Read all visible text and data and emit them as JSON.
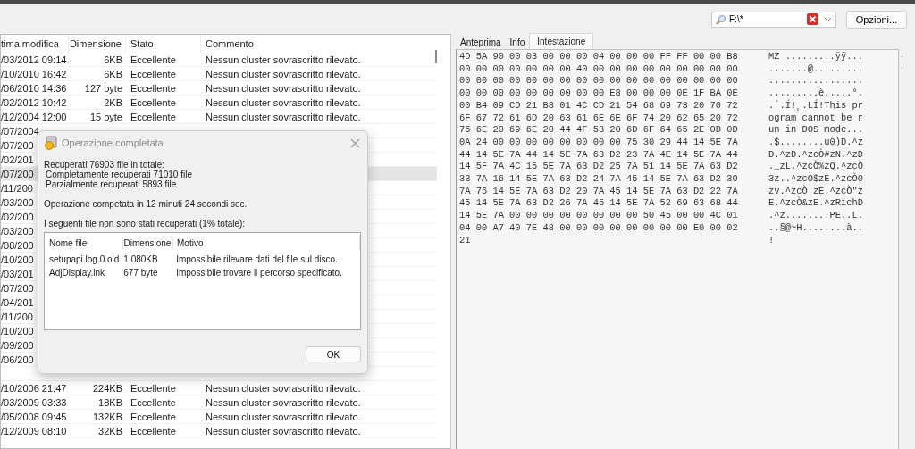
{
  "search": {
    "value": "F:\\*"
  },
  "options_button": "Opzioni...",
  "table": {
    "columns": [
      "tima modifica",
      "Dimensione",
      "Stato",
      "Commento"
    ],
    "rows": [
      {
        "modified": "/03/2012 09:14",
        "size": "6KB",
        "status": "Eccellente",
        "comment": "Nessun cluster sovrascritto rilevato.",
        "selected": false
      },
      {
        "modified": "/10/2010 16:42",
        "size": "6KB",
        "status": "Eccellente",
        "comment": "Nessun cluster sovrascritto rilevato.",
        "selected": false
      },
      {
        "modified": "/06/2010 14:36",
        "size": "127 byte",
        "status": "Eccellente",
        "comment": "Nessun cluster sovrascritto rilevato.",
        "selected": false
      },
      {
        "modified": "/02/2012 10:42",
        "size": "2KB",
        "status": "Eccellente",
        "comment": "Nessun cluster sovrascritto rilevato.",
        "selected": false
      },
      {
        "modified": "/12/2004 12:00",
        "size": "15 byte",
        "status": "Eccellente",
        "comment": "Nessun cluster sovrascritto rilevato.",
        "selected": false
      },
      {
        "modified": "/07/2004",
        "selected": false
      },
      {
        "modified": "/07/200",
        "selected": false
      },
      {
        "modified": "/02/201",
        "selected": false
      },
      {
        "modified": "/07/200",
        "selected": true
      },
      {
        "modified": "/11/200",
        "selected": false
      },
      {
        "modified": "/03/200",
        "selected": false
      },
      {
        "modified": "/02/200",
        "selected": false
      },
      {
        "modified": "/03/200",
        "selected": false
      },
      {
        "modified": "/08/200",
        "selected": false
      },
      {
        "modified": "/10/200",
        "selected": false
      },
      {
        "modified": "/03/201",
        "selected": false
      },
      {
        "modified": "/07/200",
        "selected": false
      },
      {
        "modified": "/04/201",
        "selected": false
      },
      {
        "modified": "/11/200",
        "selected": false
      },
      {
        "modified": "/10/200",
        "selected": false
      },
      {
        "modified": "/09/200",
        "selected": false
      },
      {
        "modified": "/06/200",
        "selected": false
      },
      {
        "selected": false
      },
      {
        "modified": "/10/2006 21:47",
        "size": "224KB",
        "status": "Eccellente",
        "comment": "Nessun cluster sovrascritto rilevato.",
        "selected": false
      },
      {
        "modified": "/03/2009 03:33",
        "size": "18KB",
        "status": "Eccellente",
        "comment": "Nessun cluster sovrascritto rilevato.",
        "selected": false
      },
      {
        "modified": "/05/2008 09:45",
        "size": "132KB",
        "status": "Eccellente",
        "comment": "Nessun cluster sovrascritto rilevato.",
        "selected": false
      },
      {
        "modified": "/12/2009 08:10",
        "size": "32KB",
        "status": "Eccellente",
        "comment": "Nessun cluster sovrascritto rilevato.",
        "selected": false
      }
    ]
  },
  "tabs": [
    {
      "label": "Anteprima",
      "selected": false
    },
    {
      "label": "Info",
      "selected": false
    },
    {
      "label": "Intestazione",
      "selected": true
    }
  ],
  "hex_lines": [
    {
      "hex": "4D 5A 90 00 03 00 00 00 04 00 00 00 FF FF 00 00 B8",
      "ascii": "MZ .........ÿÿ..."
    },
    {
      "hex": "00 00 00 00 00 00 00 40 00 00 00 00 00 00 00 00 00",
      "ascii": ".......@........."
    },
    {
      "hex": "00 00 00 00 00 00 00 00 00 00 00 00 00 00 00 00 00",
      "ascii": "................."
    },
    {
      "hex": "00 00 00 00 00 00 00 00 00 E8 00 00 00 0E 1F BA 0E",
      "ascii": ".........è.....°."
    },
    {
      "hex": "00 B4 09 CD 21 B8 01 4C CD 21 54 68 69 73 20 70 72",
      "ascii": ".´.Í!¸.LÍ!This pr"
    },
    {
      "hex": "6F 67 72 61 6D 20 63 61 6E 6E 6F 74 20 62 65 20 72",
      "ascii": "ogram cannot be r"
    },
    {
      "hex": "75 6E 20 69 6E 20 44 4F 53 20 6D 6F 64 65 2E 0D 0D",
      "ascii": "un in DOS mode..."
    },
    {
      "hex": "0A 24 00 00 00 00 00 00 00 00 75 30 29 44 14 5E 7A",
      "ascii": ".$........u0)D.^z"
    },
    {
      "hex": "44 14 5E 7A 44 14 5E 7A 63 D2 23 7A 4E 14 5E 7A 44",
      "ascii": "D.^zD.^zcÒ#zN.^zD"
    },
    {
      "hex": "14 5F 7A 4C 15 5E 7A 63 D2 25 7A 51 14 5E 7A 63 D2",
      "ascii": "._zL.^zcÒ%zQ.^zcÒ"
    },
    {
      "hex": "33 7A 16 14 5E 7A 63 D2 24 7A 45 14 5E 7A 63 D2 30",
      "ascii": "3z..^zcÒ$zE.^zcÒ0"
    },
    {
      "hex": "7A 76 14 5E 7A 63 D2 20 7A 45 14 5E 7A 63 D2 22 7A",
      "ascii": "zv.^zcÒ zE.^zcÒ\"z"
    },
    {
      "hex": "45 14 5E 7A 63 D2 26 7A 45 14 5E 7A 52 69 63 68 44",
      "ascii": "E.^zcÒ&zE.^zRichD"
    },
    {
      "hex": "14 5E 7A 00 00 00 00 00 00 00 00 50 45 00 00 4C 01",
      "ascii": ".^z........PE..L."
    },
    {
      "hex": "04 00 A7 40 7E 48 00 00 00 00 00 00 00 00 E0 00 02",
      "ascii": "..§@~H........à.."
    },
    {
      "hex": "21",
      "ascii": "!"
    }
  ],
  "dialog": {
    "title": "Operazione completata",
    "summary": "Recuperati 76903 file in totale:",
    "details": [
      "Completamente recuperati 71010 file",
      "Parzialmente recuperati 5893 file"
    ],
    "duration": "Operazione competata in 12 minuti 24 secondi sec.",
    "failed_label": "I seguenti file non sono stati recuperati (1% totale):",
    "columns": [
      "Nome file",
      "Dimensione",
      "Motivo"
    ],
    "rows": [
      [
        "setupapi.log.0.old",
        "1.080KB",
        "Impossibile rilevare dati del file sul disco."
      ],
      [
        "AdjDisplay.lnk",
        "677 byte",
        "Impossibile trovare il percorso specificato."
      ]
    ],
    "ok_button": "OK"
  }
}
